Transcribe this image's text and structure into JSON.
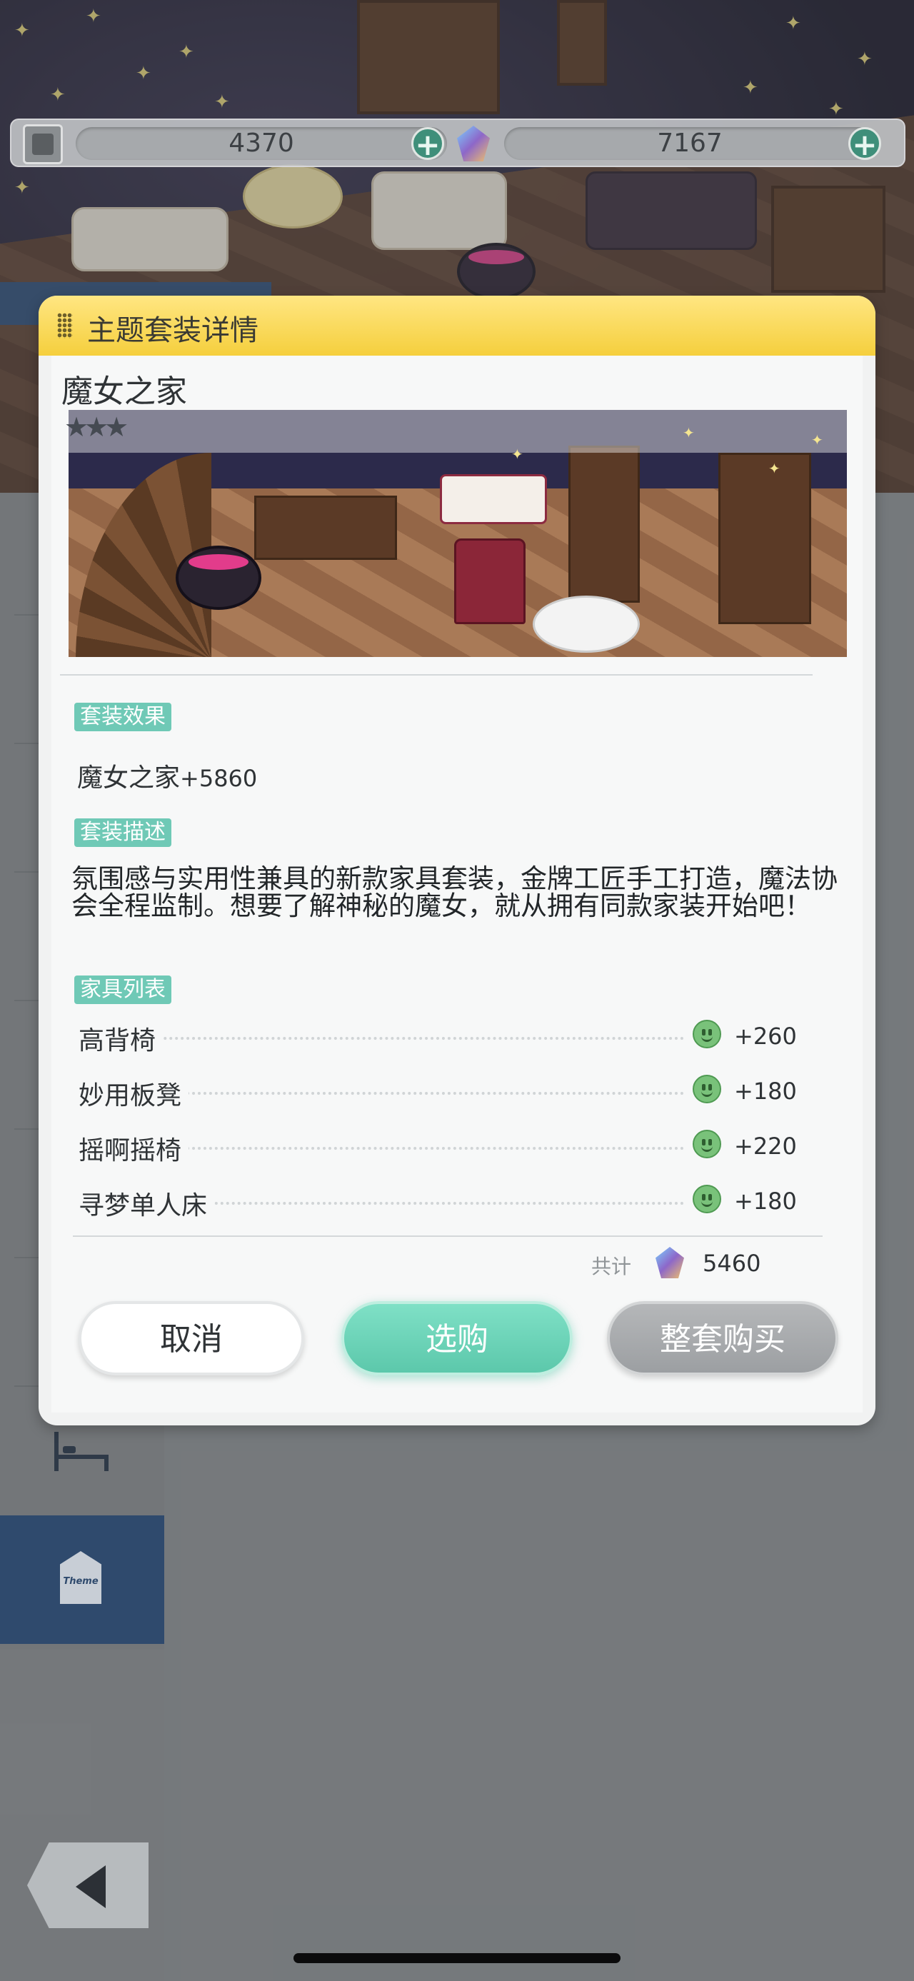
{
  "resources": {
    "stone_amount": "4370",
    "crystal_amount": "7167"
  },
  "dialog": {
    "header_title": "主题套装详情",
    "set_name": "魔女之家",
    "rating_stars": 3,
    "sections": {
      "effect_tag": "套装效果",
      "effect_name": "魔女之家",
      "effect_value": "+5860",
      "desc_tag": "套装描述",
      "description": "氛围感与实用性兼具的新款家具套装，金牌工匠手工打造，魔法协会全程监制。想要了解神秘的魔女，就从拥有同款家装开始吧！",
      "list_tag": "家具列表"
    },
    "furniture": [
      {
        "name": "高背椅",
        "value": "+260"
      },
      {
        "name": "妙用板凳",
        "value": "+180"
      },
      {
        "name": "摇啊摇椅",
        "value": "+220"
      },
      {
        "name": "寻梦单人床",
        "value": "+180"
      }
    ],
    "total_label": "共计",
    "total_value": "5460",
    "buttons": {
      "cancel": "取消",
      "select": "选购",
      "buy_all": "整套购买"
    }
  },
  "colors": {
    "header_yellow": "#f5cf3d",
    "tag_teal": "#6fc9b6",
    "select_green": "#5cc8ab",
    "sidebar_active": "#2f4a6d"
  },
  "icons": [
    "stone-icon",
    "crystal-icon",
    "plus-icon",
    "bed-icon",
    "theme-tag-icon",
    "back-arrow-icon",
    "smile-icon"
  ]
}
